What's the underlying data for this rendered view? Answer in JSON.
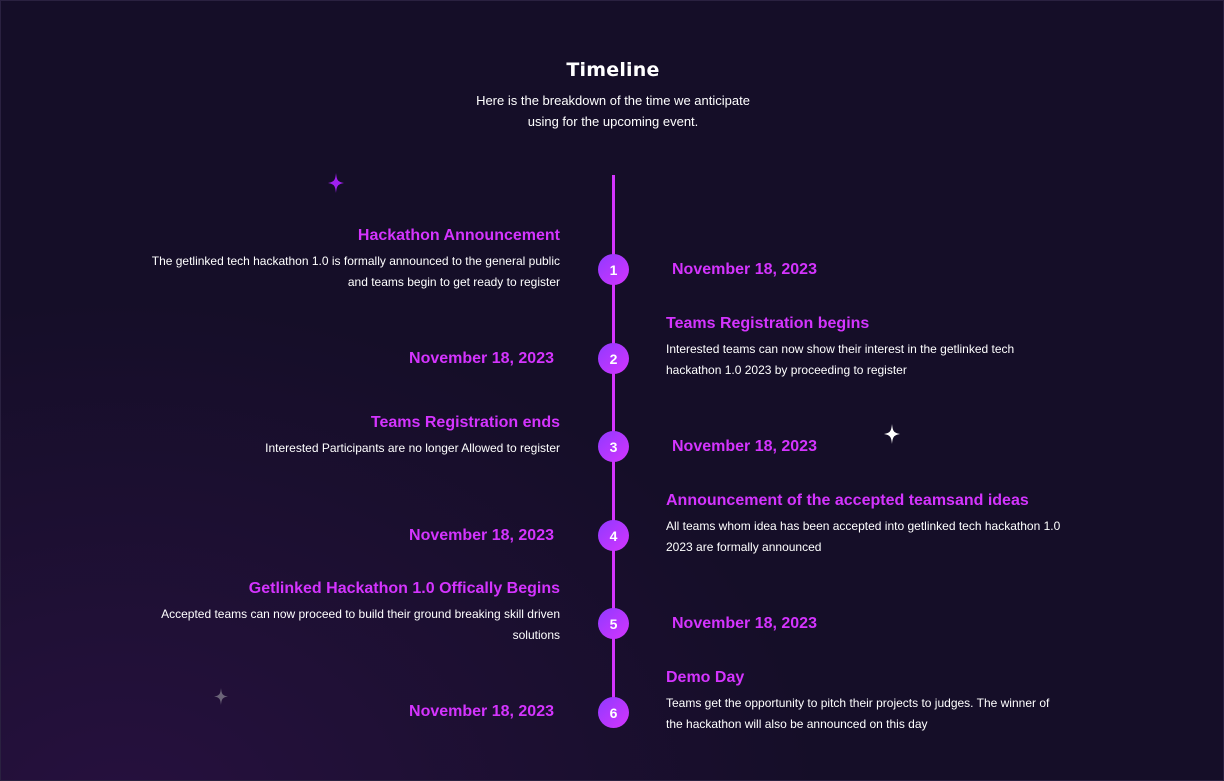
{
  "header": {
    "title": "Timeline",
    "subtitle": "Here is the breakdown of the time we anticipate using for the upcoming event."
  },
  "colors": {
    "background": "#150e28",
    "accent": "#d434fe",
    "node_gradient_start": "#903aff",
    "node_gradient_end": "#d434fe",
    "text": "#ffffff"
  },
  "timeline": [
    {
      "number": "1",
      "title": "Hackathon Announcement",
      "description": "The getlinked tech hackathon 1.0 is formally announced to the general public and teams begin to get ready to register",
      "date": "November 18, 2023"
    },
    {
      "number": "2",
      "title": "Teams Registration begins",
      "description": "Interested teams can now show their interest in the getlinked tech hackathon 1.0 2023 by proceeding to register",
      "date": "November 18, 2023"
    },
    {
      "number": "3",
      "title": "Teams Registration ends",
      "description": "Interested Participants are no longer Allowed to register",
      "date": "November 18, 2023"
    },
    {
      "number": "4",
      "title": "Announcement of the accepted teamsand ideas",
      "description": "All teams whom idea has been accepted into getlinked tech hackathon 1.0 2023 are formally announced",
      "date": "November 18, 2023"
    },
    {
      "number": "5",
      "title": "Getlinked Hackathon 1.0 Offically Begins",
      "description": "Accepted teams can now proceed to build their ground breaking skill driven solutions",
      "date": "November 18, 2023"
    },
    {
      "number": "6",
      "title": "Demo Day",
      "description": "Teams get the opportunity to pitch their projects to judges. The winner of the hackathon will also be announced on this day",
      "date": "November 18, 2023"
    }
  ],
  "decorations": {
    "star_icons": [
      "sparkle-star-icon",
      "sparkle-star-icon",
      "sparkle-star-icon"
    ]
  }
}
